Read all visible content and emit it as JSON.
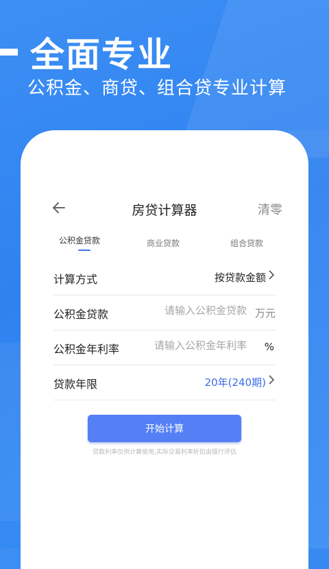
{
  "hero": {
    "title": "全面专业",
    "subtitle": "公积金、商贷、组合贷专业计算"
  },
  "nav": {
    "back_icon": "back-arrow-icon",
    "title": "房贷计算器",
    "clear_label": "清零"
  },
  "tabs": [
    {
      "label": "公积金贷款",
      "active": true
    },
    {
      "label": "商业贷款",
      "active": false
    },
    {
      "label": "组合贷款",
      "active": false
    }
  ],
  "form": {
    "method": {
      "label": "计算方式",
      "value": "按贷款金额"
    },
    "loan": {
      "label": "公积金贷款",
      "placeholder": "请输入公积金贷款",
      "unit": "万元"
    },
    "rate": {
      "label": "公积金年利率",
      "placeholder": "请输入公积金年利率",
      "unit": "%"
    },
    "term": {
      "label": "贷款年限",
      "value": "20年(240期)"
    }
  },
  "calc_button": "开始计算",
  "disclaimer": "贷款利率仅供计算使用,实际交易利率折扣由银行评估",
  "colors": {
    "accent": "#5580f5",
    "tab_indicator": "#3b74f1",
    "term_value": "#3b6be8",
    "background": "#3d8ff4"
  }
}
